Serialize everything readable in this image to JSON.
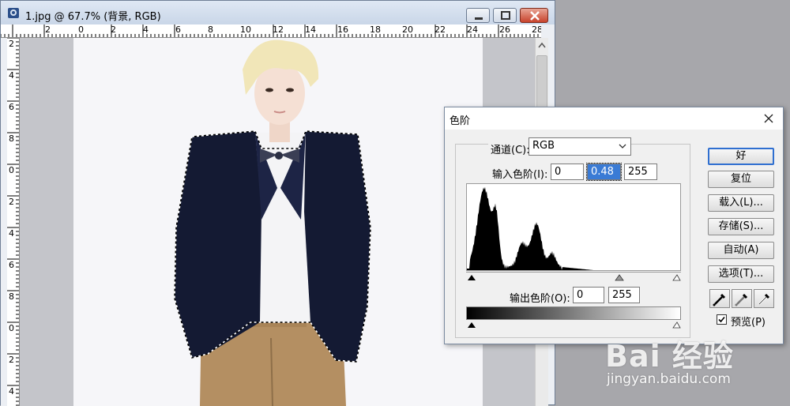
{
  "document": {
    "title": "1.jpg @ 67.7% (背景, RGB)",
    "ruler_top_labels": [
      "2",
      "0",
      "2",
      "4",
      "6",
      "8",
      "10",
      "12",
      "14",
      "16",
      "18",
      "20",
      "22",
      "24",
      "26",
      "28"
    ],
    "ruler_left_labels": [
      "2",
      "4",
      "6",
      "8",
      "0",
      "2",
      "4",
      "6",
      "8",
      "0",
      "2",
      "4"
    ]
  },
  "levels_dialog": {
    "title": "色阶",
    "channel_label": "通道(C):",
    "channel_value": "RGB",
    "input_levels_label": "输入色阶(I):",
    "input_black": "0",
    "input_gamma": "0.48",
    "input_white": "255",
    "output_levels_label": "输出色阶(O):",
    "output_black": "0",
    "output_white": "255",
    "buttons": {
      "ok": "好",
      "reset": "复位",
      "load": "载入(L)...",
      "save": "存储(S)...",
      "auto": "自动(A)",
      "options": "选项(T)..."
    },
    "preview_label": "预览(P)",
    "preview_checked": true
  },
  "watermark": {
    "brand": "Bai 经验",
    "url": "jingyan.baidu.com"
  }
}
